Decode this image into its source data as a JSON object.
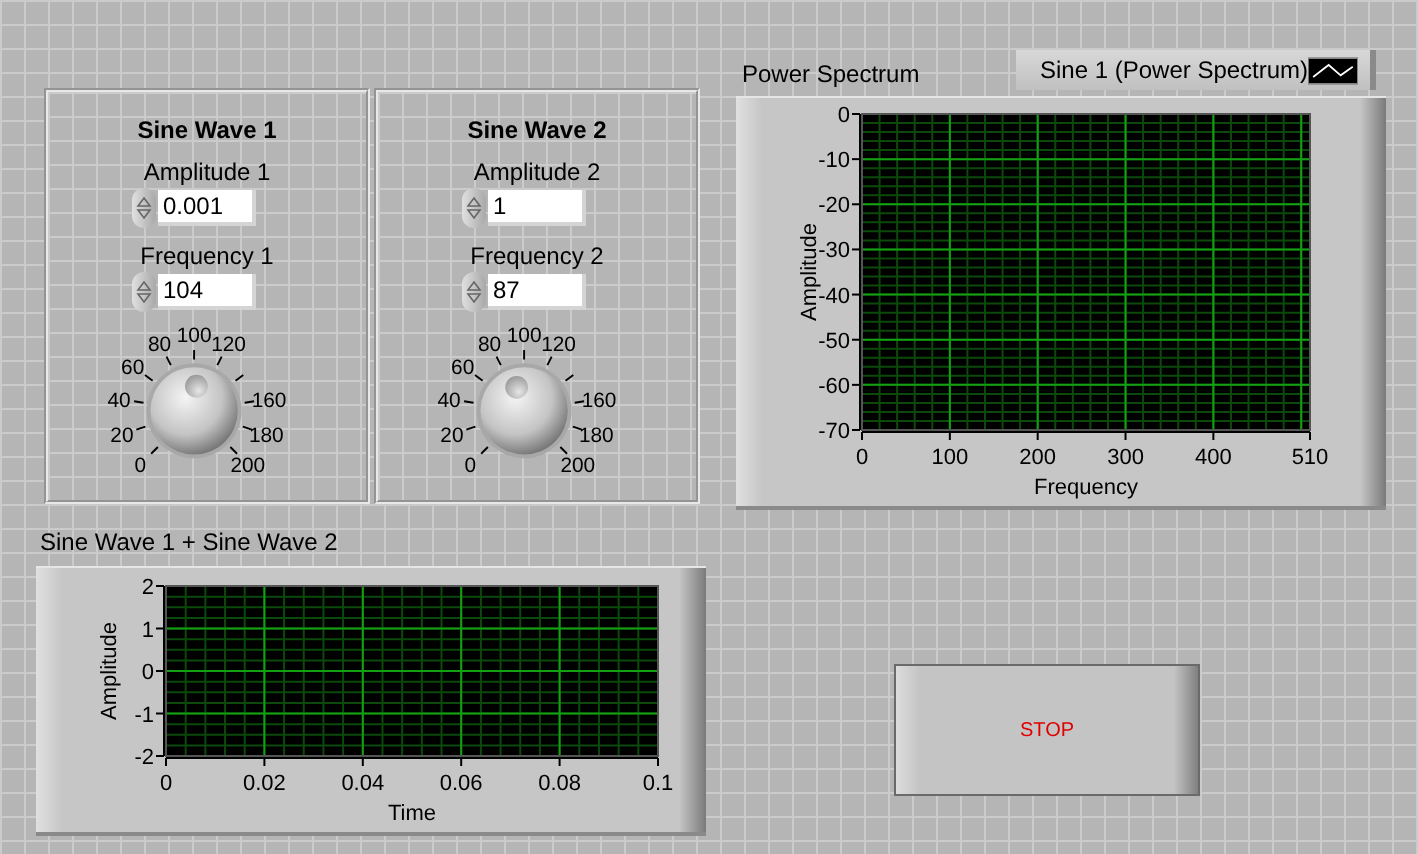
{
  "panels": [
    {
      "title": "Sine Wave 1",
      "amplitude": {
        "label": "Amplitude 1",
        "value": "0.001"
      },
      "frequency": {
        "label": "Frequency 1",
        "value": "104"
      },
      "knob": {
        "level": 0.52,
        "scale_labels": [
          "0",
          "20",
          "40",
          "60",
          "80",
          "100",
          "120",
          "160",
          "180",
          "200"
        ]
      }
    },
    {
      "title": "Sine Wave 2",
      "amplitude": {
        "label": "Amplitude 2",
        "value": "1"
      },
      "frequency": {
        "label": "Frequency 2",
        "value": "87"
      },
      "knob": {
        "level": 0.435,
        "scale_labels": [
          "0",
          "20",
          "40",
          "60",
          "80",
          "100",
          "120",
          "160",
          "180",
          "200"
        ]
      }
    }
  ],
  "spectrum_graph": {
    "label": "Power Spectrum",
    "legend": {
      "name": "Sine 1 (Power Spectrum)"
    },
    "chart_data": {
      "type": "line",
      "xlabel": "Frequency",
      "ylabel": "Amplitude",
      "xlim": [
        0,
        510
      ],
      "ylim": [
        -70,
        0
      ],
      "xticks": [
        0,
        100,
        200,
        300,
        400,
        510
      ],
      "yticks": [
        0,
        -10,
        -20,
        -30,
        -40,
        -50,
        -60,
        -70
      ],
      "grid": true
    }
  },
  "waveform_graph": {
    "label": "Sine Wave 1 + Sine Wave 2",
    "chart_data": {
      "type": "line",
      "xlabel": "Time",
      "ylabel": "Amplitude",
      "xlim": [
        0,
        0.1
      ],
      "ylim": [
        -2,
        2
      ],
      "xticks": [
        0,
        0.02,
        0.04,
        0.06,
        0.08,
        0.1
      ],
      "yticks": [
        2,
        1,
        0,
        -1,
        -2
      ],
      "grid": true
    }
  },
  "stop_button": {
    "label": "STOP"
  }
}
